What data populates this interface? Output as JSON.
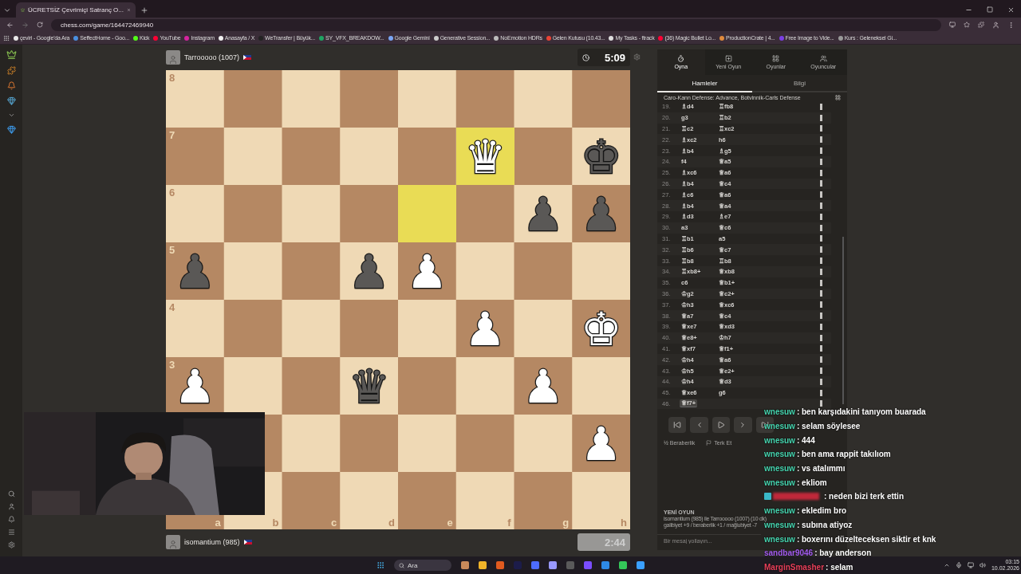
{
  "browser": {
    "tab": {
      "title": "ÜCRETSİZ Çevrimiçi Satranç O..."
    },
    "address": "chess.com/game/164472469940",
    "bookmarks": [
      {
        "label": "çeviri - Google'da Ara",
        "color": "#e8e8e8"
      },
      {
        "label": "SeffectHome - Goo...",
        "color": "#4a8fe0"
      },
      {
        "label": "Kick",
        "color": "#53fc18"
      },
      {
        "label": "YouTube",
        "color": "#ff0033"
      },
      {
        "label": "Instagram",
        "color": "#d6249f"
      },
      {
        "label": "Anasayfa / X",
        "color": "#f0f0f0"
      },
      {
        "label": "WeTransfer | Büyük...",
        "color": "#222222"
      },
      {
        "label": "SY_VFX_BREAKDOW...",
        "color": "#1fa463"
      },
      {
        "label": "Google Gemini",
        "color": "#7aa5f5"
      },
      {
        "label": "Generative Session...",
        "color": "#cccccc"
      },
      {
        "label": "NoEmotion HDRs",
        "color": "#bbbbbb"
      },
      {
        "label": "Gelen Kutusu (10.43...",
        "color": "#ea4335"
      },
      {
        "label": "My Tasks - ftrack",
        "color": "#dddddd"
      },
      {
        "label": "(36) Magic Bullet Lo...",
        "color": "#ff0033"
      },
      {
        "label": "ProductionCrate | 4...",
        "color": "#e08a3c"
      },
      {
        "label": "Free Image to Vide...",
        "color": "#7b3fe4"
      },
      {
        "label": "Kurs : Geleneksel Gi...",
        "color": "#999999"
      }
    ]
  },
  "game": {
    "top_player": {
      "name": "Tarrooooo (1007)",
      "clock": "5:09",
      "active": true
    },
    "board": {
      "file_labels": [
        "a",
        "b",
        "c",
        "d",
        "e",
        "f",
        "g",
        "h"
      ],
      "rows": [
        {
          "label": "8",
          "cells": [
            {},
            {},
            {},
            {},
            {},
            {},
            {},
            {}
          ]
        },
        {
          "label": "7",
          "cells": [
            {},
            {},
            {},
            {},
            {},
            {
              "highlighted": true,
              "glyph": "♛",
              "white": true
            },
            {},
            {
              "glyph": "♚",
              "white": false
            }
          ]
        },
        {
          "label": "6",
          "cells": [
            {},
            {},
            {},
            {},
            {
              "highlighted": true
            },
            {},
            {
              "glyph": "♟",
              "white": false
            },
            {
              "glyph": "♟",
              "white": false
            }
          ]
        },
        {
          "label": "5",
          "cells": [
            {
              "glyph": "♟",
              "white": false
            },
            {},
            {},
            {
              "glyph": "♟",
              "white": false
            },
            {
              "glyph": "♟",
              "white": true
            },
            {},
            {},
            {}
          ]
        },
        {
          "label": "4",
          "cells": [
            {},
            {},
            {},
            {},
            {},
            {
              "glyph": "♟",
              "white": true
            },
            {},
            {
              "glyph": "♚",
              "white": true
            }
          ]
        },
        {
          "label": "3",
          "cells": [
            {
              "glyph": "♟",
              "white": true
            },
            {},
            {},
            {
              "glyph": "♛",
              "white": false
            },
            {},
            {},
            {
              "glyph": "♟",
              "white": true
            },
            {}
          ]
        },
        {
          "cells": [
            {},
            {},
            {},
            {},
            {},
            {},
            {},
            {
              "glyph": "♟",
              "white": true
            }
          ]
        },
        {
          "cells": [
            {},
            {},
            {},
            {},
            {},
            {},
            {},
            {}
          ]
        }
      ]
    },
    "bottom_player": {
      "name": "isomantium (985)",
      "clock": "2:44",
      "active": false
    }
  },
  "panel": {
    "tabs": [
      {
        "label": "Oyna",
        "selected": true
      },
      {
        "label": "Yeni Oyun",
        "selected": false
      },
      {
        "label": "Oyunlar",
        "selected": false
      },
      {
        "label": "Oyuncular",
        "selected": false
      }
    ],
    "subtabs": [
      {
        "label": "Hamleler",
        "selected": true
      },
      {
        "label": "Bilgi",
        "selected": false
      }
    ],
    "opening": "Caro-Kann Defense: Advance, Botvinnik-Carls Defense",
    "moves": [
      {
        "number": "19.",
        "white": "♗d4",
        "black": "♖fb8",
        "selected": false
      },
      {
        "number": "20.",
        "white": "g3",
        "black": "♖b2",
        "selected": false
      },
      {
        "number": "21.",
        "white": "♖c2",
        "black": "♖xc2",
        "selected": false
      },
      {
        "number": "22.",
        "white": "♗xc2",
        "black": "h6",
        "selected": false
      },
      {
        "number": "23.",
        "white": "♗b4",
        "black": "♗g5",
        "selected": false
      },
      {
        "number": "24.",
        "white": "f4",
        "black": "♕a5",
        "selected": false
      },
      {
        "number": "25.",
        "white": "♗xc6",
        "black": "♕a6",
        "selected": false
      },
      {
        "number": "26.",
        "white": "♗b4",
        "black": "♕c4",
        "selected": false
      },
      {
        "number": "27.",
        "white": "♗c6",
        "black": "♕a6",
        "selected": false
      },
      {
        "number": "28.",
        "white": "♗b4",
        "black": "♕a4",
        "selected": false
      },
      {
        "number": "29.",
        "white": "♗d3",
        "black": "♗e7",
        "selected": false
      },
      {
        "number": "30.",
        "white": "a3",
        "black": "♕c6",
        "selected": false
      },
      {
        "number": "31.",
        "white": "♖b1",
        "black": "a5",
        "selected": false
      },
      {
        "number": "32.",
        "white": "♖b6",
        "black": "♕c7",
        "selected": false
      },
      {
        "number": "33.",
        "white": "♖b8",
        "black": "♖b8",
        "selected": false
      },
      {
        "number": "34.",
        "white": "♖xb8+",
        "black": "♕xb8",
        "selected": false
      },
      {
        "number": "35.",
        "white": "c6",
        "black": "♕b1+",
        "selected": false
      },
      {
        "number": "36.",
        "white": "♔g2",
        "black": "♕c2+",
        "selected": false
      },
      {
        "number": "37.",
        "white": "♔h3",
        "black": "♕xc6",
        "selected": false
      },
      {
        "number": "38.",
        "white": "♕a7",
        "black": "♕c4",
        "selected": false
      },
      {
        "number": "39.",
        "white": "♕xe7",
        "black": "♕xd3",
        "selected": false
      },
      {
        "number": "40.",
        "white": "♕e8+",
        "black": "♔h7",
        "selected": false
      },
      {
        "number": "41.",
        "white": "♕xf7",
        "black": "♕f1+",
        "selected": false
      },
      {
        "number": "42.",
        "white": "♔h4",
        "black": "♕a6",
        "selected": false
      },
      {
        "number": "43.",
        "white": "♔h5",
        "black": "♕e2+",
        "selected": false
      },
      {
        "number": "44.",
        "white": "♔h4",
        "black": "♕d3",
        "selected": false
      },
      {
        "number": "45.",
        "white": "♕xe6",
        "black": "g6",
        "selected": false
      },
      {
        "number": "46.",
        "white": "♕f7+",
        "selected": true
      }
    ],
    "draw": "½ Beraberlik",
    "resign": "Terk Et",
    "new_game": {
      "title": "YENİ OYUN",
      "line": "isomantium (985) ile Tarrooooo (1007) (10 dk)",
      "record": "galibiyet +9 / beraberlik +1 / mağlubiyet -7"
    },
    "message": {
      "placeholder": "Bir mesaj yollayın..."
    }
  },
  "chat": [
    {
      "kind": "user",
      "user": "wnesuw",
      "color": "#45d3ae",
      "text": ": ben karşıdakini tanıyom buarada"
    },
    {
      "kind": "user",
      "user": "wnesuw",
      "color": "#45d3ae",
      "text": ": selam söylesee"
    },
    {
      "kind": "user",
      "user": "wnesuw",
      "color": "#45d3ae",
      "text": ": 444"
    },
    {
      "kind": "user",
      "user": "wnesuw",
      "color": "#45d3ae",
      "text": ": ben ama rappit takılıom"
    },
    {
      "kind": "user",
      "user": "wnesuw",
      "color": "#45d3ae",
      "text": ": vs atalımmı"
    },
    {
      "kind": "user",
      "user": "wnesuw",
      "color": "#45d3ae",
      "text": ": ekliom"
    },
    {
      "kind": "redacted",
      "color": "#c0283a",
      "text": ": neden bizi terk ettin"
    },
    {
      "kind": "user",
      "user": "wnesuw",
      "color": "#45d3ae",
      "text": ": ekledim bro"
    },
    {
      "kind": "user",
      "user": "wnesuw",
      "color": "#45d3ae",
      "text": ": subına atiyoz"
    },
    {
      "kind": "user",
      "user": "wnesuw",
      "color": "#45d3ae",
      "text": ": boxerını düzelteceksen siktir et knk"
    },
    {
      "kind": "user",
      "user": "sandbar9046",
      "color": "#a45cf0",
      "text": ": bay anderson"
    },
    {
      "kind": "user",
      "user": "MarginSmasher",
      "color": "#e8405a",
      "text": ": selam"
    }
  ],
  "taskbar": {
    "search": "Ara",
    "time": "03:15",
    "date": "10.02.2026"
  }
}
